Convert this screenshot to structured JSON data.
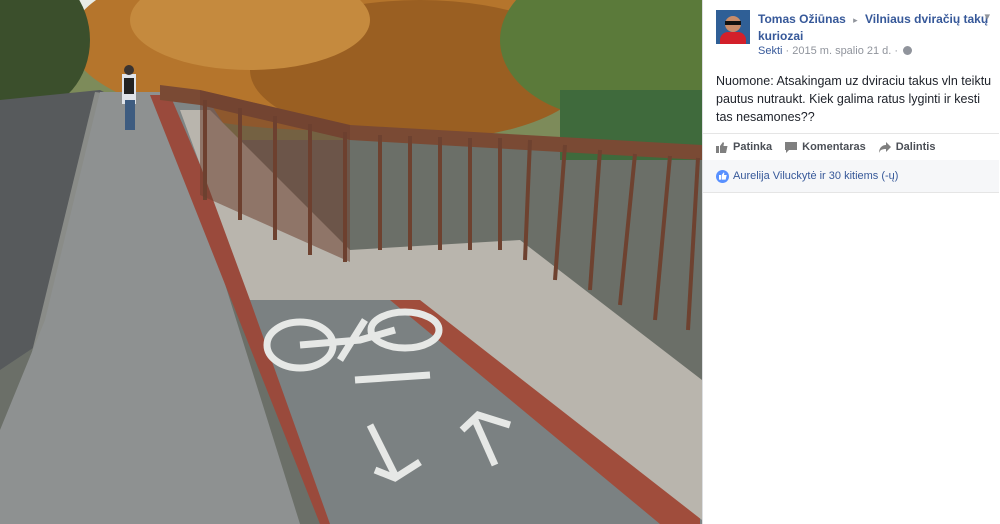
{
  "post": {
    "author": "Tomas Ožiūnas",
    "separator": "▸",
    "group": "Vilniaus dviračių takų kuriozai",
    "follow": "Sekti",
    "dot": "·",
    "date": "2015 m. spalio 21 d.",
    "text": "Nuomone: Atsakingam uz dviraciu takus vln teiktu pautus nutraukt. Kiek galima ratus lyginti ir kesti tas nesamones??"
  },
  "actions": {
    "like": "Patinka",
    "comment": "Komentaras",
    "share": "Dalintis"
  },
  "reactions": {
    "summary": "Aurelija Viluckytė ir 30 kitiems (-ų)"
  },
  "colors": {
    "link": "#365899",
    "meta": "#90949c",
    "like_badge": "#5890ff"
  },
  "icons": {
    "like": "thumbs-up-icon",
    "comment": "comment-bubble-icon",
    "share": "share-arrow-icon",
    "privacy": "globe-icon",
    "menu": "chevron-down-icon"
  }
}
